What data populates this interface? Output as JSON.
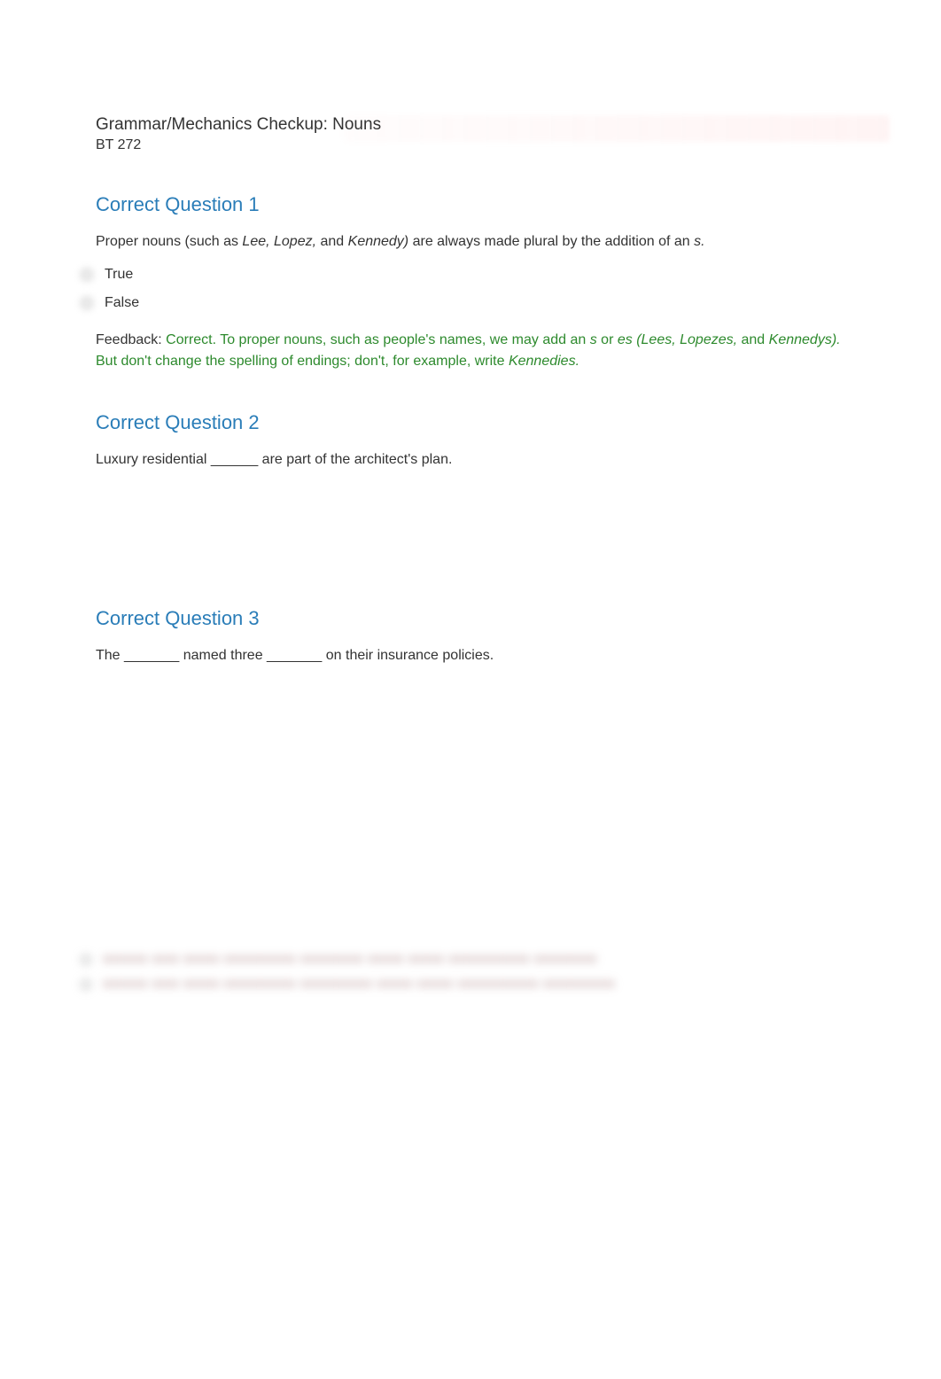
{
  "header": {
    "title": "Grammar/Mechanics Checkup: Nouns",
    "subtitle": "BT 272"
  },
  "questions": [
    {
      "heading": "Correct Question 1",
      "prompt_parts": {
        "before1": "Proper nouns (such as ",
        "italic1": "Lee, Lopez,",
        "mid1": " and ",
        "italic2": "Kennedy)",
        "after1": " are always made plural by the addition of an ",
        "italic3": "s.",
        "after2": ""
      },
      "options": [
        {
          "label": "True"
        },
        {
          "label": "False"
        }
      ],
      "feedback": {
        "label": "Feedback: ",
        "seg1": "Correct. To proper nouns, such as people's names, we may add an ",
        "i1": "s",
        "seg2": " or ",
        "i2": "es (Lees, Lopezes,",
        "seg3": " and ",
        "i3": "Kennedys).",
        "seg4": " But don't change the spelling of endings; don't, for example, write ",
        "i4": "Kennedies.",
        "seg5": ""
      }
    },
    {
      "heading": "Correct Question 2",
      "prompt_plain": "Luxury residential ______ are part of the architect's plan."
    },
    {
      "heading": "Correct Question 3",
      "prompt_plain": "The _______ named three _______ on their insurance policies."
    }
  ],
  "hidden_options": [
    {
      "text": "■■■■■ ■■■ ■■■■ ■■■■■■■■ ■■■■■■■ ■■■■ ■■■■ ■■■■■■■■■ ■■■■■■■"
    },
    {
      "text": "■■■■■ ■■■ ■■■■ ■■■■■■■■ ■■■■■■■■ ■■■■ ■■■■ ■■■■■■■■■ ■■■■■■■■"
    }
  ]
}
